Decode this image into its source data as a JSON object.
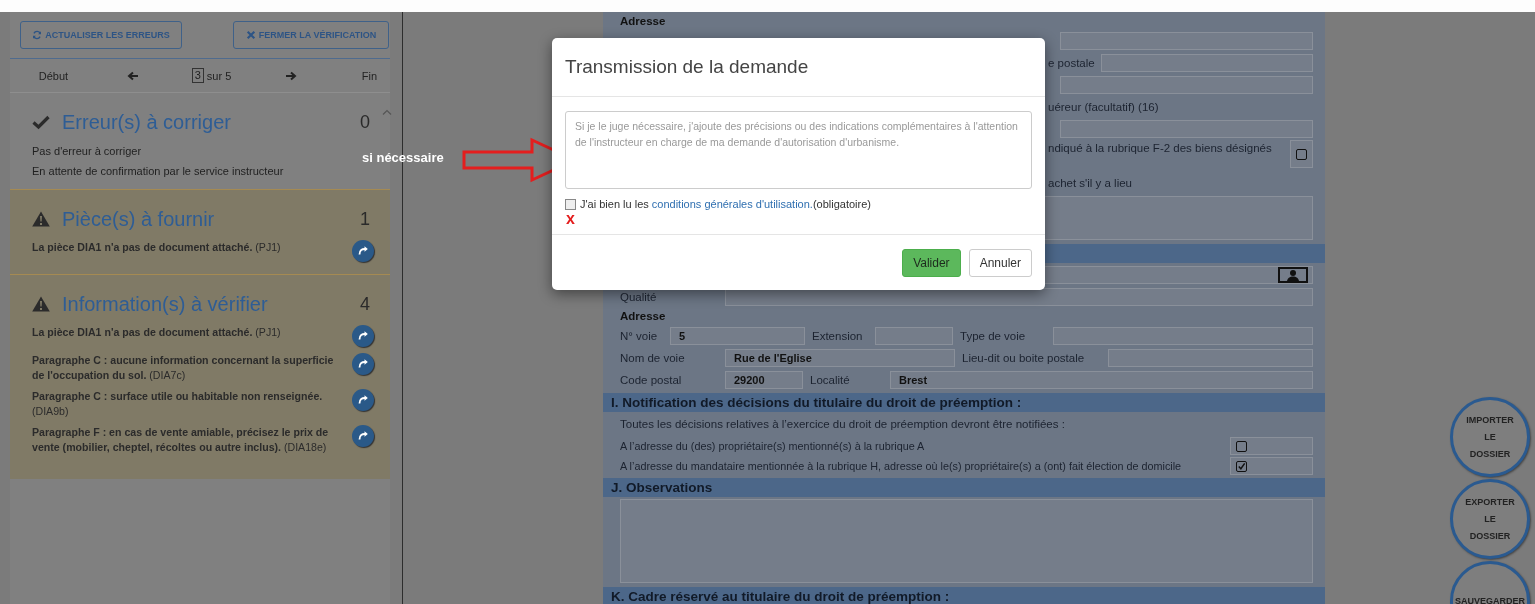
{
  "left_panel": {
    "buttons": [
      {
        "kind": "refresh",
        "label": "ACTUALISER LES ERREURS"
      },
      {
        "kind": "close",
        "label": "FERMER LA VÉRIFICATION"
      }
    ],
    "pager": {
      "first": "Début",
      "page": "3",
      "of": "sur 5",
      "last": "Fin"
    },
    "sections": [
      {
        "kind": "ok",
        "title": "Erreur(s) à corriger",
        "count": "0",
        "collapse_toggle": true,
        "lines": [
          "Pas d'erreur à corriger",
          "En attente de confirmation par le service instructeur"
        ]
      },
      {
        "kind": "warning",
        "title": "Pièce(s) à fournir",
        "count": "1",
        "items": [
          "**La pièce DIA1 n'a pas de document attaché.** (PJ1)"
        ]
      },
      {
        "kind": "warning",
        "title": "Information(s) à vérifier",
        "count": "4",
        "items": [
          "**La pièce DIA1 n'a pas de document attaché.** (PJ1)",
          "**Paragraphe C : aucune information concernant la superficie de l'occupation du sol.** (DIA7c)",
          "**Paragraphe C : surface utile ou habitable non renseignée.** (DIA9b)",
          "**Paragraphe F : en cas de vente amiable, précisez le prix de vente (mobilier, cheptel, récoltes ou autre inclus).** (DIA18e)"
        ]
      }
    ]
  },
  "form": {
    "rows": [
      {
        "kind": "subheading",
        "text": "Adresse"
      },
      {
        "kind": "blank"
      },
      {
        "kind": "tail",
        "text": "e postale",
        "field": true
      },
      {
        "kind": "blank"
      },
      {
        "kind": "tail",
        "text": "uéreur (facultatif) (16)"
      },
      {
        "kind": "blank"
      },
      {
        "kind": "tailcheck",
        "text": "ndiqué à la rubrique F-2 des biens désignés",
        "checked": false
      },
      {
        "kind": "tail",
        "text": "achet s'il y a lieu"
      },
      {
        "kind": "area"
      },
      {
        "kind": "header"
      },
      {
        "kind": "photo"
      },
      {
        "kind": "labelfield",
        "label": "Qualité"
      },
      {
        "kind": "subheading",
        "text": "Adresse"
      },
      {
        "kind": "triple",
        "cells": [
          {
            "label": "N° voie",
            "value": "5"
          },
          {
            "label": "Extension"
          },
          {
            "label": "Type de voie"
          }
        ]
      },
      {
        "kind": "pair",
        "cells": [
          {
            "label": "Nom de voie",
            "value": "Rue de l'Eglise"
          },
          {
            "label": "Lieu-dit ou boite postale"
          }
        ]
      },
      {
        "kind": "narrow",
        "cells": [
          {
            "label": "Code postal",
            "value": "29200"
          },
          {
            "label": "Localité",
            "value": "Brest"
          }
        ]
      },
      {
        "kind": "header",
        "text": "I. Notification des décisions du titulaire du droit de préemption :"
      },
      {
        "kind": "note",
        "text": "Toutes les décisions relatives à l’exercice du droit de préemption devront être notifiées :"
      },
      {
        "kind": "check",
        "text": "A l’adresse du (des) propriétaire(s) mentionné(s) à la rubrique A",
        "checked": false
      },
      {
        "kind": "check",
        "text": "A l’adresse du mandataire mentionnée à la rubrique H, adresse où le(s) propriétaire(s) a (ont) fait élection de domicile",
        "checked": true
      },
      {
        "kind": "header",
        "text": "J. Observations"
      },
      {
        "kind": "largearea"
      },
      {
        "kind": "header",
        "text": "K. Cadre réservé au titulaire du droit de préemption :"
      }
    ]
  },
  "modal": {
    "title": "Transmission de la demande",
    "placeholder": "Si je le juge nécessaire, j'ajoute des précisions ou des indications complémentaires à l'attention de l'instructeur en charge de ma demande d'autorisation d'urbanisme.",
    "agree": {
      "checked": false,
      "before": "J'ai bien lu les ",
      "link": "conditions générales d'utilisation.",
      "after": "(obligatoire)"
    },
    "buttons": [
      {
        "kind": "primary",
        "label": "Valider"
      },
      {
        "kind": "default",
        "label": "Annuler"
      }
    ]
  },
  "annotation": {
    "label": "si nécessaire",
    "mark": "x"
  },
  "actions": [
    "IMPORTER LE DOSSIER",
    "EXPORTER LE DOSSIER",
    "SAUVEGARDER"
  ]
}
